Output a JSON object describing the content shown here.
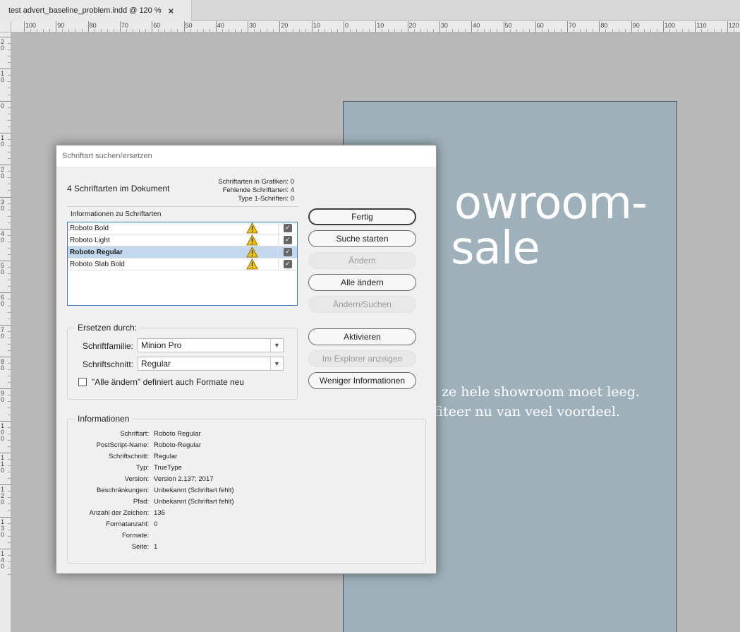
{
  "tab": {
    "title": "test advert_baseline_problem.indd @ 120 %",
    "close": "×"
  },
  "ruler": {
    "h_labels": [
      "100",
      "90",
      "80",
      "70",
      "60",
      "50",
      "40",
      "30",
      "20",
      "10",
      "0",
      "10",
      "20",
      "30",
      "40",
      "50",
      "60",
      "70",
      "80",
      "90",
      "100",
      "110",
      "120"
    ],
    "v_labels": [
      "20",
      "10",
      "0",
      "10",
      "20",
      "30",
      "40",
      "50",
      "60",
      "70",
      "80",
      "90",
      "100",
      "110",
      "120",
      "130",
      "140"
    ]
  },
  "page": {
    "headline_line1": "owroom-",
    "headline_line2": "sale",
    "body_line1": "ze hele showroom moet leeg.",
    "body_line2": "fiteer nu van veel voordeel."
  },
  "dialog": {
    "title": "Schriftart suchen/ersetzen",
    "fonts_count": "4 Schriftarten im Dokument",
    "stats": [
      "Schriftarten in Grafiken: 0",
      "Fehlende Schriftarten: 4",
      "Type 1-Schriften: 0"
    ],
    "list_heading": "Informationen zu Schriftarten",
    "fonts": [
      {
        "name": "Roboto Bold",
        "missing": true,
        "checked": true
      },
      {
        "name": "Roboto Light",
        "missing": true,
        "checked": true
      },
      {
        "name": "Roboto Regular",
        "missing": true,
        "checked": true,
        "selected": true
      },
      {
        "name": "Roboto Slab Bold",
        "missing": true,
        "checked": true
      }
    ],
    "buttons": {
      "done": "Fertig",
      "find_first": "Suche starten",
      "change": "Ändern",
      "change_all": "Alle ändern",
      "change_find": "Ändern/Suchen",
      "activate": "Aktivieren",
      "reveal_explorer": "Im Explorer anzeigen",
      "less_info": "Weniger Informationen"
    },
    "replace": {
      "title": "Ersetzen durch:",
      "family_label": "Schriftfamilie:",
      "family_value": "Minion Pro",
      "style_label": "Schriftschnitt:",
      "style_value": "Regular",
      "redefine_label": "\"Alle ändern\" definiert auch Formate neu",
      "redefine_checked": false
    },
    "info": {
      "title": "Informationen",
      "rows": [
        {
          "label": "Schriftart:",
          "value": "Roboto Regular"
        },
        {
          "label": "PostScript-Name:",
          "value": "Roboto-Regular"
        },
        {
          "label": "Schriftschnitt:",
          "value": "Regular"
        },
        {
          "label": "Typ:",
          "value": "TrueType"
        },
        {
          "label": "Version:",
          "value": "Version 2.137; 2017"
        },
        {
          "label": "Beschränkungen:",
          "value": "Unbekannt (Schriftart fehlt)"
        },
        {
          "label": "Pfad:",
          "value": "Unbekannt (Schriftart fehlt)"
        },
        {
          "label": "Anzahl der Zeichen:",
          "value": "136"
        },
        {
          "label": "Formatanzahl:",
          "value": "0"
        },
        {
          "label": "Formate:",
          "value": ""
        },
        {
          "label": "Seite:",
          "value": "1"
        }
      ]
    }
  },
  "colors": {
    "page_fill": "#9eb0b9",
    "selection": "#c3d7ee",
    "list_border": "#3c7fc1",
    "warning": "#f5c400"
  }
}
